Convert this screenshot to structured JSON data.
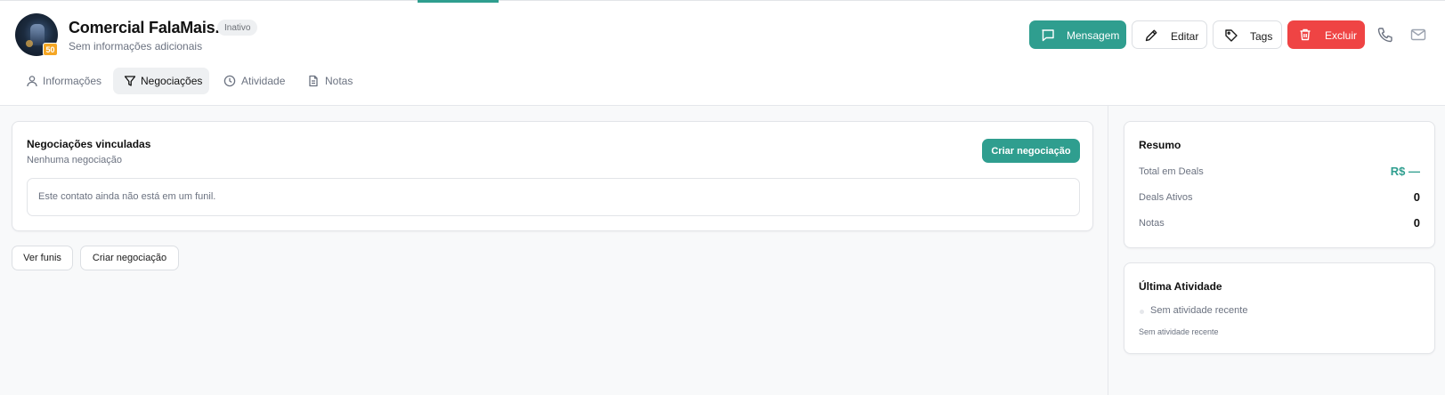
{
  "contact": {
    "name": "Comercial FalaMais.Ai",
    "status": "Inativo",
    "subtitle": "Sem informações adicionais",
    "level": "50"
  },
  "actions": {
    "message": "Mensagem",
    "edit": "Editar",
    "tags": "Tags",
    "delete": "Excluir"
  },
  "tabs": [
    {
      "label": "Informações",
      "icon": "user-icon"
    },
    {
      "label": "Negociações",
      "icon": "filter-icon",
      "active": true
    },
    {
      "label": "Atividade",
      "icon": "clock-icon"
    },
    {
      "label": "Notas",
      "icon": "note-icon"
    }
  ],
  "deals": {
    "title": "Negociações vinculadas",
    "subtitle": "Nenhuma negociação",
    "create_label": "Criar negociação",
    "empty_text": "Este contato ainda não está em um funil."
  },
  "footer_actions": {
    "view_funnels": "Ver funis",
    "create_deal": "Criar negociação"
  },
  "summary": {
    "title": "Resumo",
    "rows": [
      {
        "label": "Total em Deals",
        "value": "R$ —"
      },
      {
        "label": "Deals Ativos",
        "value": "0"
      },
      {
        "label": "Notas",
        "value": "0"
      }
    ]
  },
  "activity": {
    "title": "Última Atividade",
    "item": "Sem atividade recente",
    "footer": "Sem atividade recente"
  },
  "colors": {
    "accent": "#2f9e8f",
    "danger": "#ef4444",
    "badge": "#f5a623"
  }
}
